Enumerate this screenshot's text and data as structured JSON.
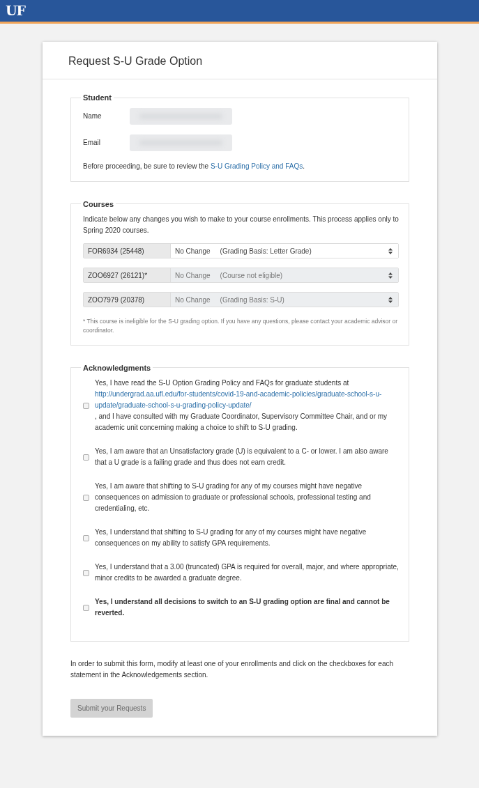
{
  "header": {
    "logo": "UF"
  },
  "title": "Request S-U Grade Option",
  "student": {
    "legend": "Student",
    "fields": [
      {
        "label": "Name",
        "redacted": true
      },
      {
        "label": "Email",
        "redacted": true
      }
    ],
    "note_before": "Before proceeding, be sure to review the ",
    "note_link": "S-U Grading Policy and FAQs",
    "note_after": "."
  },
  "courses": {
    "legend": "Courses",
    "intro": "Indicate below any changes you wish to make to your course enrollments. This process applies only to Spring 2020 courses.",
    "rows": [
      {
        "course": "FOR6934 (25448)",
        "choice": "No Change",
        "basis": "(Grading Basis: Letter Grade)",
        "disabled": false
      },
      {
        "course": "ZOO6927 (26121)*",
        "choice": "No Change",
        "basis": "(Course not eligible)",
        "disabled": true
      },
      {
        "course": "ZOO7979 (20378)",
        "choice": "No Change",
        "basis": "(Grading Basis: S-U)",
        "disabled": true
      }
    ],
    "footnote": "* This course is ineligible for the S-U grading option. If you have any questions, please contact your academic advisor or coordinator."
  },
  "acknowledgments": {
    "legend": "Acknowledgments",
    "items": [
      {
        "text_before": "Yes, I have read the S-U Option Grading Policy and FAQs for graduate students at ",
        "link": "http://undergrad.aa.ufl.edu/for-students/covid-19-and-academic-policies/graduate-school-s-u-update/graduate-school-s-u-grading-policy-update/",
        "text_after": ", and I have consulted with my Graduate Coordinator, Supervisory Committee Chair, and or my academic unit concerning making a choice to shift to S-U grading.",
        "checked": false,
        "bold": false
      },
      {
        "text_before": "Yes, I am aware that an Unsatisfactory grade (U) is equivalent to a C- or lower.  I am also aware that a U grade is a failing grade and thus does not earn credit.",
        "checked": false,
        "bold": false
      },
      {
        "text_before": "Yes, I am aware that shifting to S-U grading for any of my courses might have negative consequences on admission to graduate or professional schools, professional testing and credentialing, etc.",
        "checked": false,
        "bold": false
      },
      {
        "text_before": "Yes, I understand that shifting to S-U grading for any of my courses might have negative consequences on my ability to satisfy GPA requirements.",
        "checked": false,
        "bold": false
      },
      {
        "text_before": "Yes, I understand that a 3.00 (truncated) GPA is required for overall, major, and where appropriate, minor credits to be awarded a graduate degree.",
        "checked": false,
        "bold": false
      },
      {
        "text_before": "Yes, I understand all decisions to switch to an S-U grading option are final and cannot be reverted.",
        "checked": false,
        "bold": true
      }
    ]
  },
  "instructions": "In order to submit this form, modify at least one of your enrollments and click on the checkboxes for each statement in the Acknowledgements section.",
  "submit": {
    "label": "Submit your Requests",
    "disabled": true
  }
}
